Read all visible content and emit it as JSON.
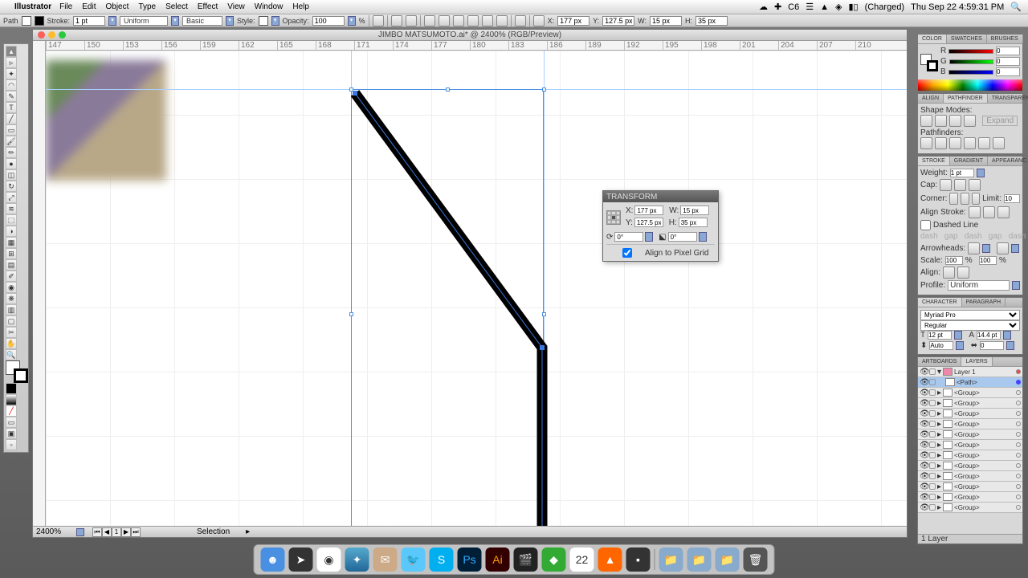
{
  "menubar": {
    "app": "Illustrator",
    "items": [
      "File",
      "Edit",
      "Object",
      "Type",
      "Select",
      "Effect",
      "View",
      "Window",
      "Help"
    ],
    "right": {
      "battery": "(Charged)",
      "datetime": "Thu Sep 22  4:59:31 PM"
    }
  },
  "controlbar": {
    "pathLabel": "Path",
    "strokeLabel": "Stroke:",
    "strokeVal": "1 pt",
    "styleLabel": "Style:",
    "uniform": "Uniform",
    "basic": "Basic",
    "opacityLabel": "Opacity:",
    "opacityVal": "100",
    "x": "X:",
    "xVal": "177 px",
    "y": "Y:",
    "yVal": "127.5 px",
    "w": "W:",
    "wVal": "15 px",
    "h": "H:",
    "hVal": "35 px"
  },
  "document": {
    "title": "JIMBO MATSUMOTO.ai* @ 2400% (RGB/Preview)",
    "zoom": "2400%",
    "status": "Selection",
    "rulerTicks": [
      "147",
      "150",
      "153",
      "156",
      "159",
      "162",
      "165",
      "168",
      "171",
      "174",
      "177",
      "180",
      "183",
      "186",
      "189",
      "192",
      "195",
      "198",
      "201",
      "204",
      "207",
      "210"
    ]
  },
  "transform": {
    "title": "TRANSFORM",
    "x": "X:",
    "xVal": "177 px",
    "y": "Y:",
    "yVal": "127.5 px",
    "w": "W:",
    "wVal": "15 px",
    "h": "H:",
    "hVal": "35 px",
    "rotate": "0°",
    "shear": "0°",
    "alignLabel": "Align to Pixel Grid"
  },
  "panelColor": {
    "tabs": [
      "COLOR",
      "SWATCHES",
      "BRUSHES"
    ],
    "r": "R",
    "g": "G",
    "b": "B",
    "rv": "0",
    "gv": "0",
    "bv": "0"
  },
  "panelPathfinder": {
    "tabs": [
      "ALIGN",
      "PATHFINDER",
      "TRANSPAREN"
    ],
    "shapeModes": "Shape Modes:",
    "pathfinders": "Pathfinders:",
    "expand": "Expand"
  },
  "panelStroke": {
    "tabs": [
      "STROKE",
      "GRADIENT",
      "APPEARANC"
    ],
    "weight": "Weight:",
    "weightVal": "1 pt",
    "cap": "Cap:",
    "corner": "Corner:",
    "limit": "Limit:",
    "limitVal": "10",
    "alignStroke": "Align Stroke:",
    "dashed": "Dashed Line",
    "dash": "dash",
    "gap": "gap",
    "arrows": "Arrowheads:",
    "scale": "Scale:",
    "scaleV1": "100",
    "scaleV2": "100",
    "align": "Align:",
    "profile": "Profile:",
    "uniform": "Uniform"
  },
  "panelChar": {
    "tabs": [
      "CHARACTER",
      "PARAGRAPH"
    ],
    "font": "Myriad Pro",
    "style": "Regular",
    "size": "12 pt",
    "leading": "14.4 pt",
    "auto": "Auto",
    "zero": "0"
  },
  "panelLayers": {
    "tabs": [
      "ARTBOARDS",
      "LAYERS"
    ],
    "layer": "Layer 1",
    "path": "<Path>",
    "group": "<Group>",
    "footer": "1 Layer"
  },
  "dock": {
    "items": [
      "finder",
      "arrow",
      "chrome",
      "safari",
      "mail",
      "twitter",
      "skype",
      "ps",
      "ai",
      "imovie",
      "misc",
      "cal",
      "vlc",
      "term",
      "",
      "",
      "trash"
    ],
    "calDay": "22"
  }
}
